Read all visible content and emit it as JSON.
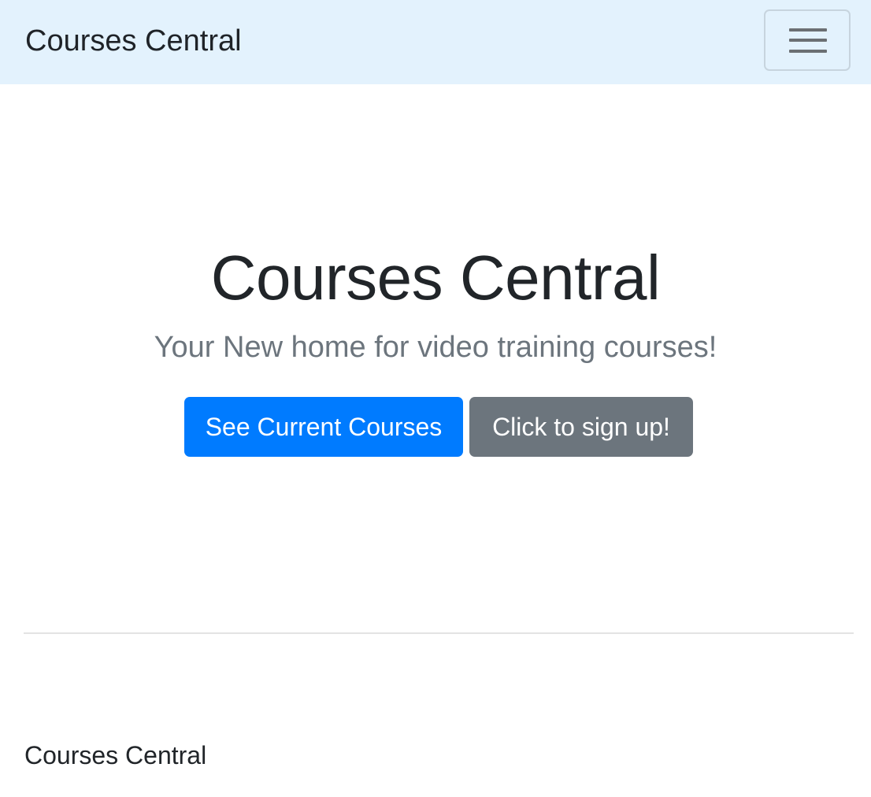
{
  "navbar": {
    "brand": "Courses Central",
    "toggler_icon": "hamburger-menu-icon"
  },
  "hero": {
    "title": "Courses Central",
    "lead": "Your New home for video training courses!",
    "primary_button": "See Current Courses",
    "secondary_button": "Click to sign up!"
  },
  "footer": {
    "text": "Courses Central"
  },
  "colors": {
    "navbar_bg": "#e3f2fd",
    "primary": "#007bff",
    "secondary": "#6c757d",
    "lead_text": "#6c757d"
  }
}
